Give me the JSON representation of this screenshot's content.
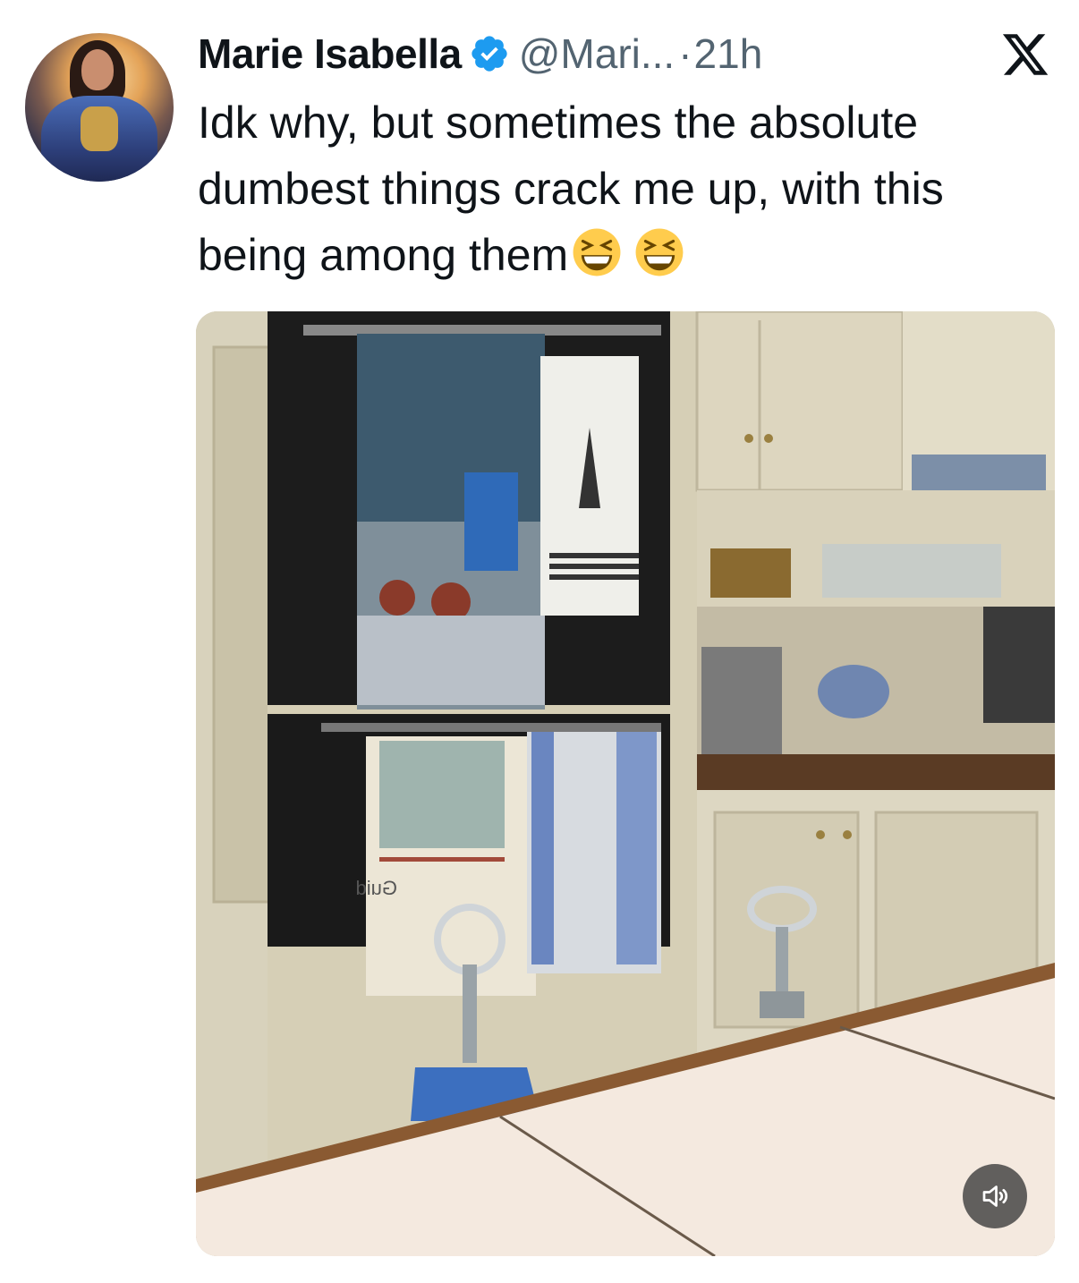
{
  "tweet": {
    "author_name": "Marie Isabella",
    "handle": "@Mari...",
    "separator": "·",
    "time_ago": "21h",
    "text": "Idk why, but sometimes the absolute dumbest things crack me up, with this being among them",
    "emojis": [
      "grinning-squinting-face",
      "grinning-squinting-face"
    ],
    "verified": true
  },
  "icons": {
    "close": "x-logo-icon",
    "verified": "verified-badge-icon",
    "sound": "speaker-icon"
  },
  "colors": {
    "verified_blue": "#1d9bf0",
    "text_primary": "#0f1419",
    "text_secondary": "#536471"
  },
  "media": {
    "type": "video",
    "towel_label": "Guid",
    "sound_muted": true
  }
}
